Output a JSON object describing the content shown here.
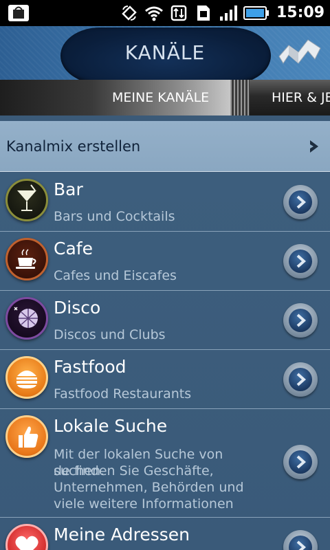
{
  "status_bar": {
    "time": "15:09",
    "icons": [
      "app-notification-icon",
      "rotate-icon",
      "wifi-icon",
      "data-transfer-icon",
      "sim-icon",
      "signal-icon",
      "battery-icon"
    ]
  },
  "header": {
    "title": "KANÄLE"
  },
  "tabs": [
    {
      "label": "MEINE KANÄLE",
      "active": true
    },
    {
      "label": "HIER & JE",
      "active": false
    }
  ],
  "create_mix": {
    "label": "Kanalmix erstellen"
  },
  "channels": [
    {
      "title": "Bar",
      "subtitle": "Bars und Cocktails",
      "icon": "cocktail-icon"
    },
    {
      "title": "Cafe",
      "subtitle": "Cafes und Eiscafes",
      "icon": "coffee-cup-icon"
    },
    {
      "title": "Disco",
      "subtitle": "Discos und Clubs",
      "icon": "disco-ball-icon"
    },
    {
      "title": "Fastfood",
      "subtitle": "Fastfood Restaurants",
      "icon": "burger-icon"
    },
    {
      "title": "Lokale Suche",
      "subtitle_lines": [
        "Mit der lokalen Suche von suchen.",
        "de finden Sie Geschäfte,",
        "Unternehmen, Behörden und",
        "viele weitere Informationen"
      ],
      "icon": "thumbs-up-icon"
    },
    {
      "title": "Meine Adressen",
      "subtitle": "",
      "icon": "heart-icon"
    }
  ],
  "colors": {
    "header_blue": "#3f78ad",
    "title_pill": "#0a1e3b",
    "list_background": "#3b5a78",
    "create_row": "#8fabc5"
  }
}
